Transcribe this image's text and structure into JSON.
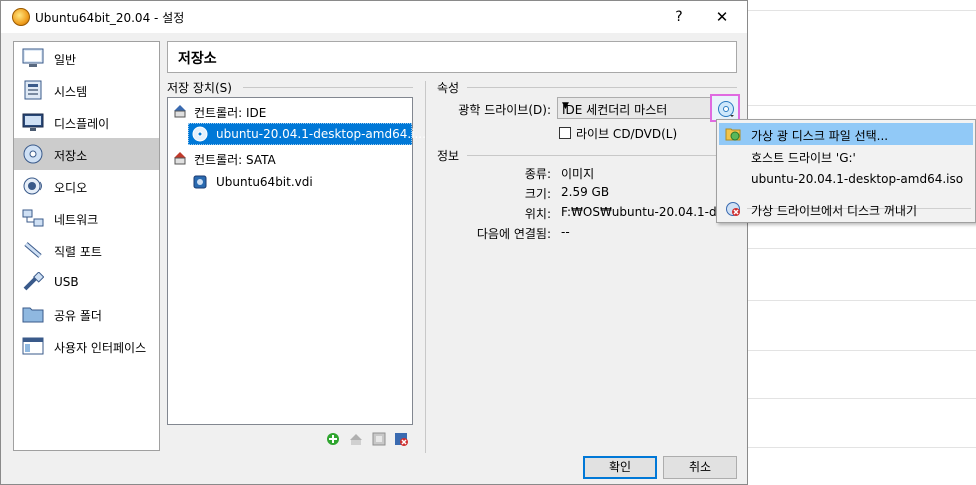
{
  "window": {
    "title": "Ubuntu64bit_20.04 - 설정",
    "help_label": "?",
    "close_label": "✕"
  },
  "sidebar": {
    "items": [
      {
        "label": "일반",
        "icon": "general-icon"
      },
      {
        "label": "시스템",
        "icon": "system-icon"
      },
      {
        "label": "디스플레이",
        "icon": "display-icon"
      },
      {
        "label": "저장소",
        "icon": "storage-icon",
        "active": true
      },
      {
        "label": "오디오",
        "icon": "audio-icon"
      },
      {
        "label": "네트워크",
        "icon": "network-icon"
      },
      {
        "label": "직렬 포트",
        "icon": "serial-port-icon"
      },
      {
        "label": "USB",
        "icon": "usb-icon"
      },
      {
        "label": "공유 폴더",
        "icon": "shared-folder-icon"
      },
      {
        "label": "사용자 인터페이스",
        "icon": "user-interface-icon"
      }
    ]
  },
  "page": {
    "title": "저장소"
  },
  "storage_devices": {
    "group_label": "저장 장치(S)",
    "tree": [
      {
        "label": "컨트롤러: IDE",
        "type": "controller"
      },
      {
        "label": "ubuntu-20.04.1-desktop-amd64.i...",
        "type": "optical",
        "selected": true
      },
      {
        "label": "컨트롤러: SATA",
        "type": "controller"
      },
      {
        "label": "Ubuntu64bit.vdi",
        "type": "disk"
      }
    ]
  },
  "attributes": {
    "group_label": "속성",
    "optical_drive_label": "광학 드라이브(D):",
    "optical_drive_value": "IDE 세컨더리 마스터",
    "live_cd_label": "라이브 CD/DVD(L)",
    "live_cd_checked": false
  },
  "info": {
    "group_label": "정보",
    "rows": [
      {
        "label": "종류:",
        "value": "이미지"
      },
      {
        "label": "크기:",
        "value": "2.59 GB"
      },
      {
        "label": "위치:",
        "value": "F:₩OS₩ubuntu-20.04.1-des"
      },
      {
        "label": "다음에 연결됨:",
        "value": "--"
      }
    ]
  },
  "context_menu": {
    "items": [
      {
        "label": "가상 광 디스크 파일 선택...",
        "icon": "folder-disc-icon",
        "highlighted": true
      },
      {
        "label": "호스트 드라이브 'G:'",
        "icon": ""
      },
      {
        "label": "ubuntu-20.04.1-desktop-amd64.iso",
        "icon": ""
      },
      {
        "label": "가상 드라이브에서 디스크 꺼내기",
        "icon": "eject-disc-icon"
      }
    ]
  },
  "buttons": {
    "ok": "확인",
    "cancel": "취소"
  },
  "colors": {
    "selection": "#0078d7",
    "menu_highlight": "#91c9f7",
    "highlight_box": "#e06ae0"
  }
}
